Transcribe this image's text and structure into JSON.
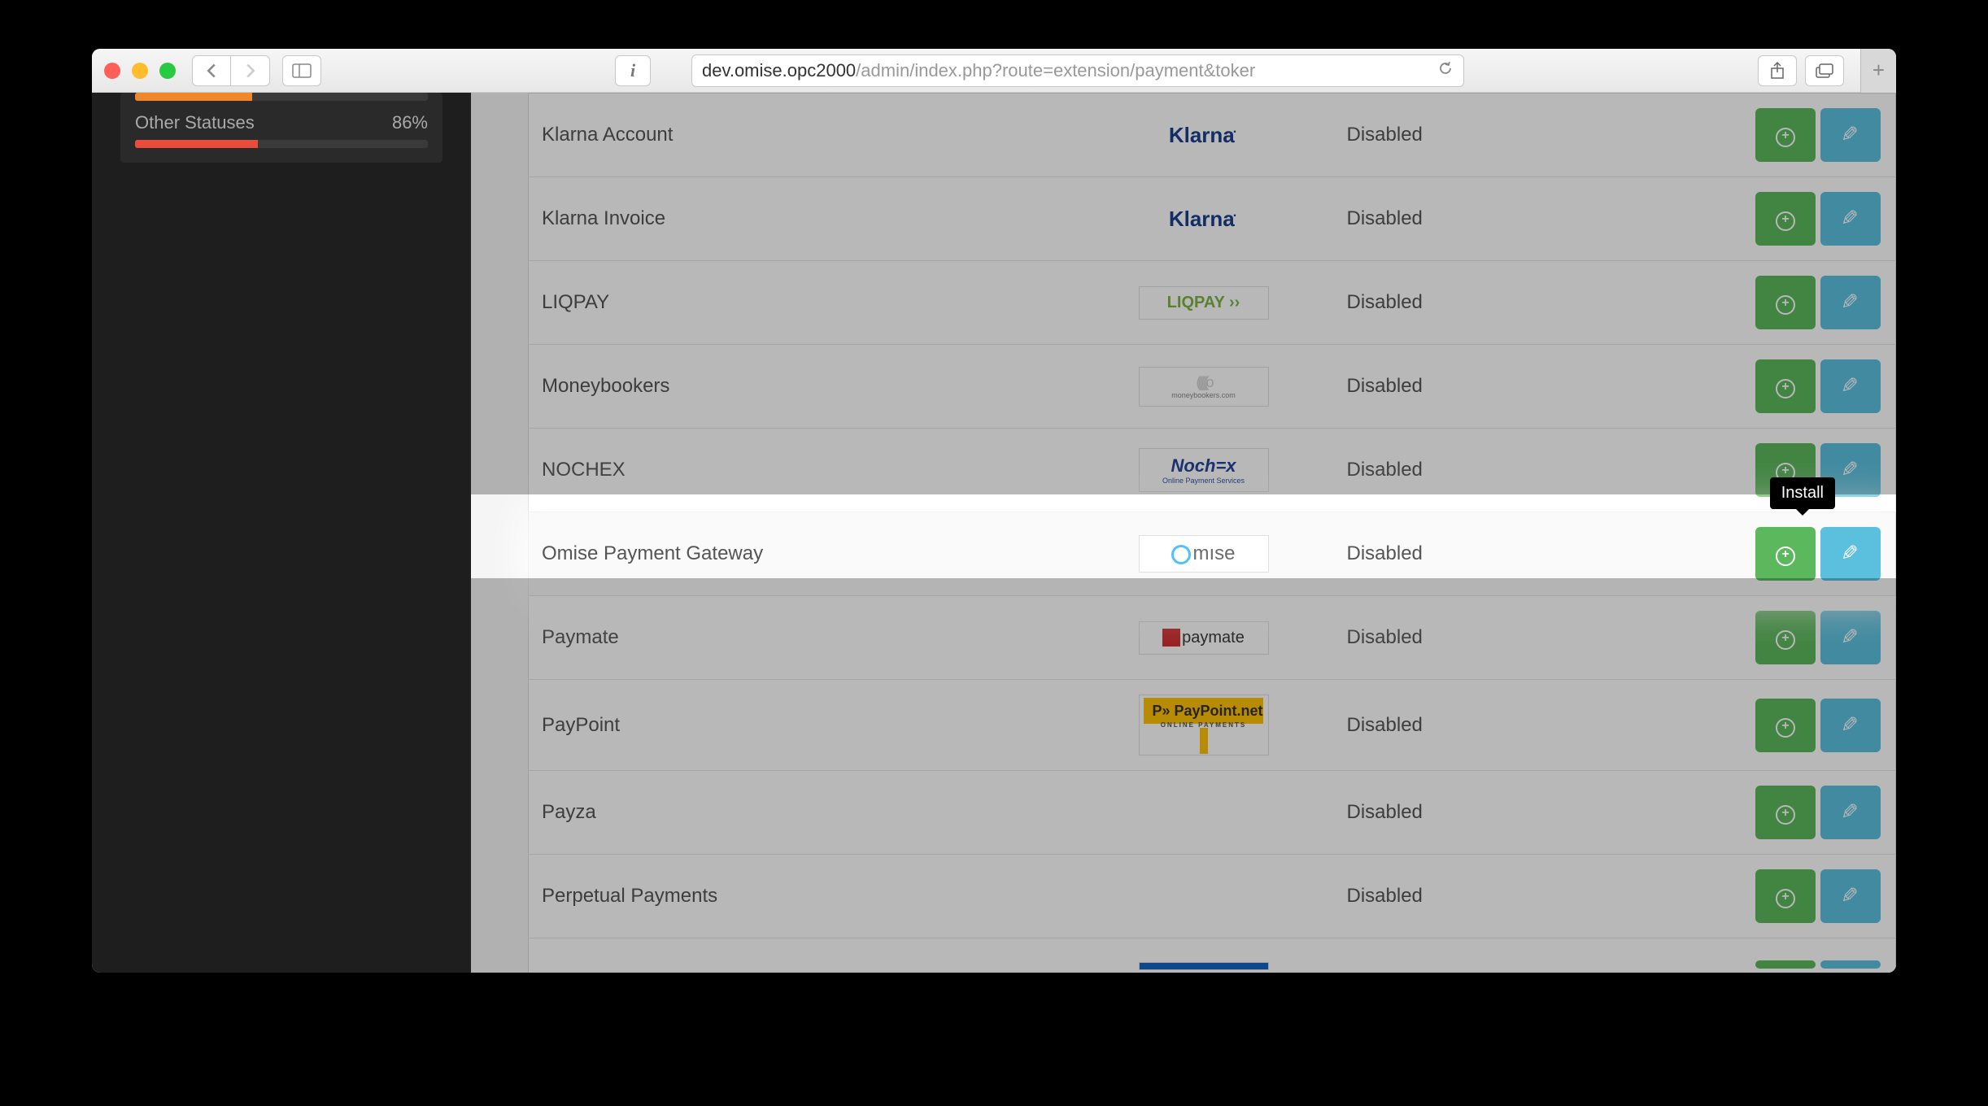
{
  "browser": {
    "url_host": "dev.omise.opc2000",
    "url_path": "/admin/index.php?route=extension/payment&toker"
  },
  "sidebar": {
    "statuses": [
      {
        "label": "",
        "percent": "",
        "width": 40,
        "color": "#f0872a"
      },
      {
        "label": "Other Statuses",
        "percent": "86%",
        "width": 42,
        "color": "#e74c3c"
      }
    ]
  },
  "table": {
    "rows": [
      {
        "name": "Klarna Account",
        "logo": "klarna",
        "status": "Disabled"
      },
      {
        "name": "Klarna Invoice",
        "logo": "klarna",
        "status": "Disabled"
      },
      {
        "name": "LIQPAY",
        "logo": "liqpay",
        "status": "Disabled"
      },
      {
        "name": "Moneybookers",
        "logo": "moneybookers",
        "status": "Disabled"
      },
      {
        "name": "NOCHEX",
        "logo": "nochex",
        "status": "Disabled"
      },
      {
        "name": "Omise Payment Gateway",
        "logo": "omise",
        "status": "Disabled",
        "highlighted": true
      },
      {
        "name": "Paymate",
        "logo": "paymate",
        "status": "Disabled"
      },
      {
        "name": "PayPoint",
        "logo": "paypoint",
        "status": "Disabled"
      },
      {
        "name": "Payza",
        "logo": "",
        "status": "Disabled"
      },
      {
        "name": "Perpetual Payments",
        "logo": "",
        "status": "Disabled"
      }
    ]
  },
  "tooltip": {
    "text": "Install"
  },
  "logos": {
    "klarna": "Klarna",
    "liqpay": "LIQPAY ››",
    "moneybookers": "((((((o",
    "nochex": "Noch=x",
    "nochex_sub": "Online Payment Services",
    "omise": "mıse",
    "paymate": "paymate",
    "paypoint": "P» PayPoint.net",
    "paypoint_sub": "ONLINE PAYMENTS"
  }
}
